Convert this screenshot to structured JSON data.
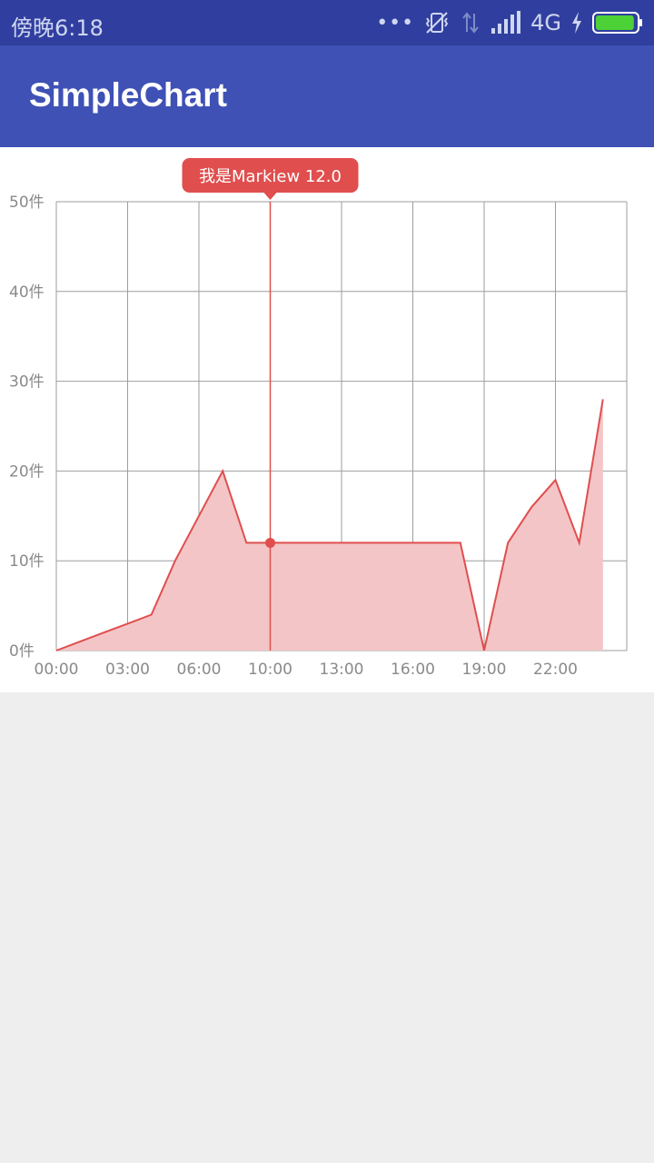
{
  "status_bar": {
    "time": "傍晚6:18",
    "network_type": "4G",
    "icons": [
      "more-dots-icon",
      "vibrate-off-icon",
      "data-transfer-icon",
      "signal-icon",
      "charging-icon",
      "battery-icon"
    ],
    "battery_level_percent": 95,
    "colors": {
      "background": "#303f9f",
      "text": "#cfd6f0",
      "battery_fill": "#4cd137"
    }
  },
  "app_bar": {
    "title": "SimpleChart",
    "color": "#3f51b5"
  },
  "chart_data": {
    "type": "area",
    "x": [
      "00:00",
      "01:00",
      "02:00",
      "03:00",
      "04:00",
      "05:00",
      "06:00",
      "07:00",
      "08:00",
      "09:00",
      "10:00",
      "11:00",
      "12:00",
      "13:00",
      "14:00",
      "15:00",
      "16:00",
      "17:00",
      "18:00",
      "19:00",
      "20:00",
      "21:00",
      "22:00",
      "23:00"
    ],
    "values": [
      0,
      1,
      2,
      3,
      4,
      10,
      15,
      20,
      12,
      12,
      12,
      12,
      12,
      12,
      12,
      12,
      12,
      12,
      0,
      12,
      16,
      19,
      12,
      28
    ],
    "x_range": [
      0,
      24
    ],
    "xticks": [
      "00:00",
      "03:00",
      "06:00",
      "10:00",
      "13:00",
      "16:00",
      "19:00",
      "22:00"
    ],
    "xtick_hours": [
      0,
      3,
      6,
      9,
      12,
      15,
      18,
      21
    ],
    "ylim": [
      0,
      50
    ],
    "yticks": [
      "0件",
      "10件",
      "20件",
      "30件",
      "40件",
      "50件"
    ],
    "ytick_values": [
      0,
      10,
      20,
      30,
      40,
      50
    ],
    "grid": true,
    "line_color": "#e04e4e",
    "fill_color": "#f4c5c7",
    "highlight": {
      "hour": 9,
      "value": 12,
      "label": "我是Markiew 12.0",
      "color": "#e04e4e"
    }
  }
}
